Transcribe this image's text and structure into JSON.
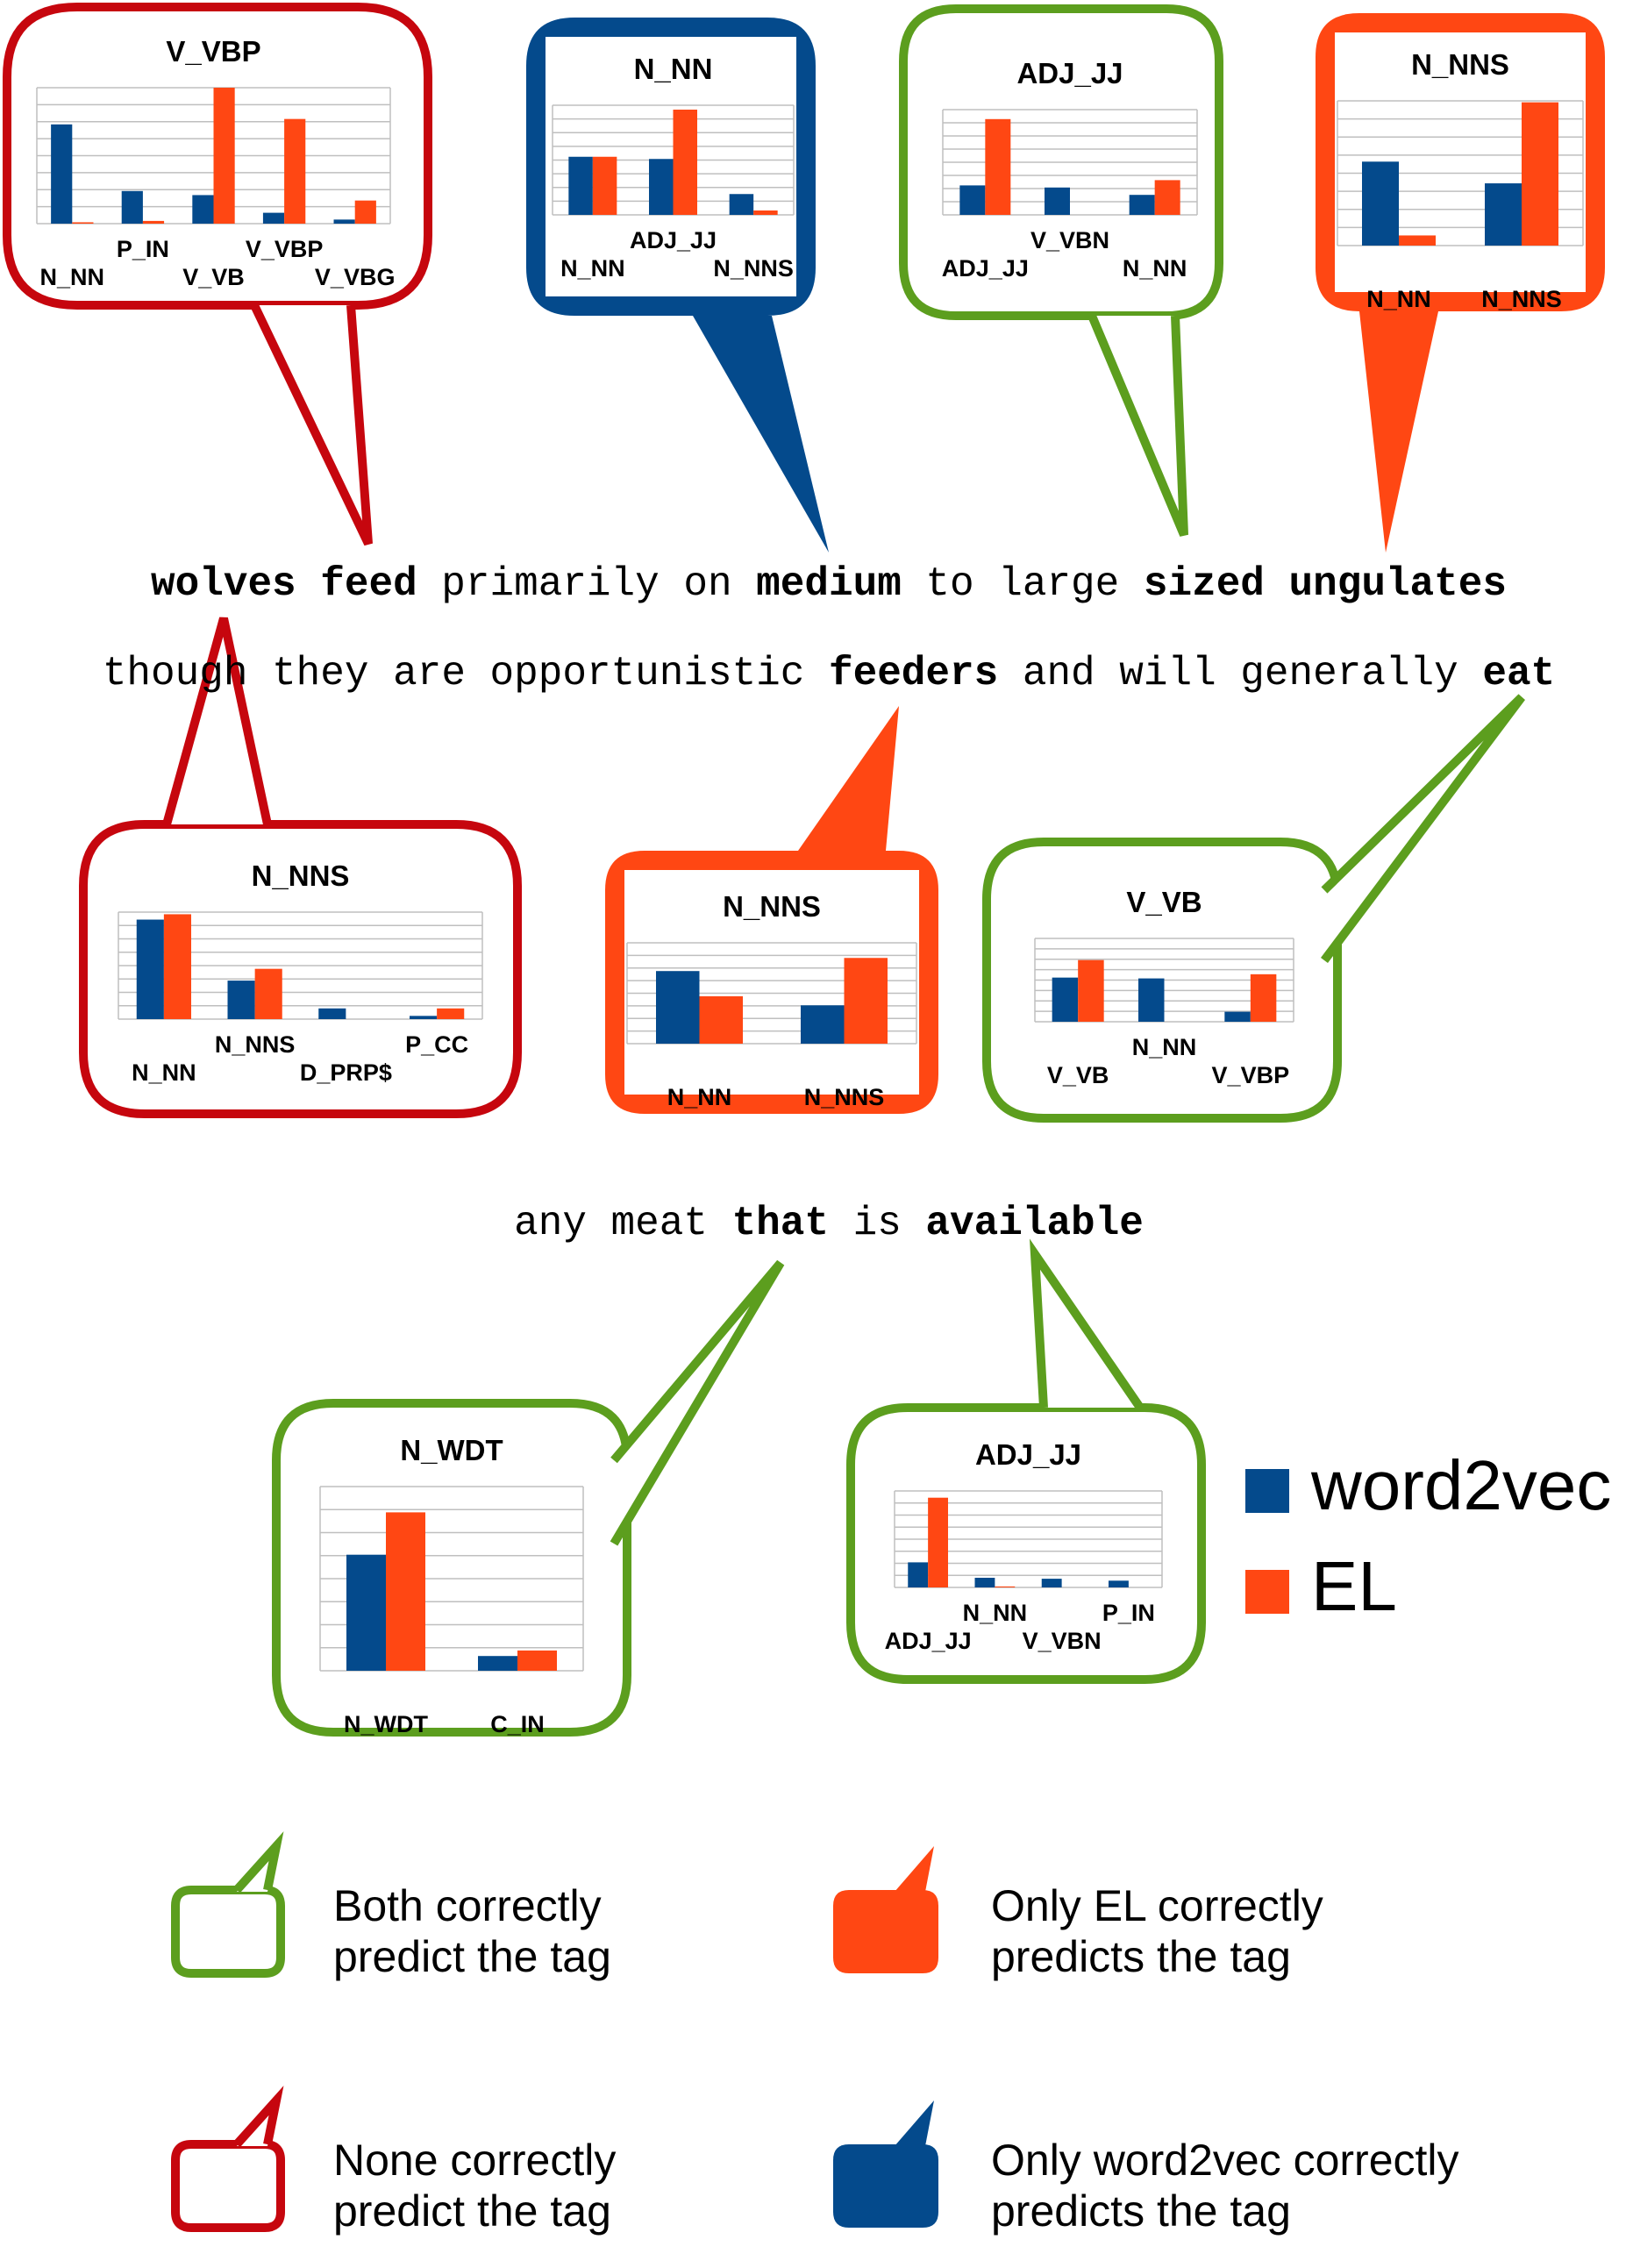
{
  "colors": {
    "word2vec": "#044A8C",
    "EL": "#FF4713",
    "both_correct": "#5C9E1E",
    "none_correct": "#C6060E",
    "only_el": "#FF4713",
    "only_word2vec": "#044A8C",
    "grid": "#BFBFBF"
  },
  "sentence": [
    [
      {
        "text": "wolves",
        "bold": true
      },
      {
        "text": "feed",
        "bold": true
      },
      {
        "text": "primarily",
        "bold": false
      },
      {
        "text": "on",
        "bold": false
      },
      {
        "text": "medium",
        "bold": true
      },
      {
        "text": "to",
        "bold": false
      },
      {
        "text": "large",
        "bold": false
      },
      {
        "text": "sized",
        "bold": true
      },
      {
        "text": "ungulates",
        "bold": true
      }
    ],
    [
      {
        "text": "though",
        "bold": false
      },
      {
        "text": "they",
        "bold": false
      },
      {
        "text": "are",
        "bold": false
      },
      {
        "text": "opportunistic",
        "bold": false
      },
      {
        "text": "feeders",
        "bold": true
      },
      {
        "text": "and",
        "bold": false
      },
      {
        "text": "will",
        "bold": false
      },
      {
        "text": "generally",
        "bold": false
      },
      {
        "text": "eat",
        "bold": true
      }
    ],
    [
      {
        "text": "any",
        "bold": false
      },
      {
        "text": "meat",
        "bold": false
      },
      {
        "text": "that",
        "bold": true
      },
      {
        "text": "is",
        "bold": false
      },
      {
        "text": "available",
        "bold": true
      }
    ]
  ],
  "chart_data": [
    {
      "type": "bar",
      "word": "wolves",
      "status": "none_correct",
      "title": "V_VBP",
      "categories": [
        "N_NN",
        "P_IN",
        "V_VB",
        "V_VBP",
        "V_VBG"
      ],
      "series": [
        {
          "name": "word2vec",
          "values": [
            0.73,
            0.24,
            0.21,
            0.08,
            0.03
          ]
        },
        {
          "name": "EL",
          "values": [
            0.01,
            0.02,
            1.0,
            0.77,
            0.17
          ]
        }
      ]
    },
    {
      "type": "bar",
      "word": "medium",
      "status": "only_word2vec",
      "title": "N_NN",
      "categories": [
        "N_NN",
        "ADJ_JJ",
        "N_NNS"
      ],
      "series": [
        {
          "name": "word2vec",
          "values": [
            0.53,
            0.51,
            0.19
          ]
        },
        {
          "name": "EL",
          "values": [
            0.53,
            0.96,
            0.04
          ]
        }
      ]
    },
    {
      "type": "bar",
      "word": "sized",
      "status": "both_correct",
      "title": "ADJ_JJ",
      "categories": [
        "ADJ_JJ",
        "V_VBN",
        "N_NN"
      ],
      "series": [
        {
          "name": "word2vec",
          "values": [
            0.28,
            0.26,
            0.19
          ]
        },
        {
          "name": "EL",
          "values": [
            0.91,
            0.0,
            0.33
          ]
        }
      ]
    },
    {
      "type": "bar",
      "word": "ungulates",
      "status": "only_el",
      "title": "N_NNS",
      "categories": [
        "N_NN",
        "N_NNS"
      ],
      "series": [
        {
          "name": "word2vec",
          "values": [
            0.58,
            0.43
          ]
        },
        {
          "name": "EL",
          "values": [
            0.07,
            0.99
          ]
        }
      ]
    },
    {
      "type": "bar",
      "word": "feed",
      "status": "none_correct",
      "title": "N_NNS",
      "categories": [
        "N_NN",
        "N_NNS",
        "D_PRP$",
        "P_CC"
      ],
      "series": [
        {
          "name": "word2vec",
          "values": [
            0.93,
            0.36,
            0.1,
            0.03
          ]
        },
        {
          "name": "EL",
          "values": [
            0.98,
            0.47,
            0.0,
            0.1
          ]
        }
      ]
    },
    {
      "type": "bar",
      "word": "feeders",
      "status": "only_el",
      "title": "N_NNS",
      "categories": [
        "N_NN",
        "N_NNS"
      ],
      "series": [
        {
          "name": "word2vec",
          "values": [
            0.72,
            0.38
          ]
        },
        {
          "name": "EL",
          "values": [
            0.47,
            0.85
          ]
        }
      ]
    },
    {
      "type": "bar",
      "word": "eat",
      "status": "both_correct",
      "title": "V_VB",
      "categories": [
        "V_VB",
        "N_NN",
        "V_VBP"
      ],
      "series": [
        {
          "name": "word2vec",
          "values": [
            0.53,
            0.52,
            0.12
          ]
        },
        {
          "name": "EL",
          "values": [
            0.74,
            0.0,
            0.57
          ]
        }
      ]
    },
    {
      "type": "bar",
      "word": "that",
      "status": "both_correct",
      "title": "N_WDT",
      "categories": [
        "N_WDT",
        "C_IN"
      ],
      "series": [
        {
          "name": "word2vec",
          "values": [
            0.63,
            0.08
          ]
        },
        {
          "name": "EL",
          "values": [
            0.86,
            0.11
          ]
        }
      ]
    },
    {
      "type": "bar",
      "word": "available",
      "status": "both_correct",
      "title": "ADJ_JJ",
      "categories": [
        "ADJ_JJ",
        "N_NN",
        "V_VBN",
        "P_IN"
      ],
      "series": [
        {
          "name": "word2vec",
          "values": [
            0.26,
            0.1,
            0.09,
            0.07
          ]
        },
        {
          "name": "EL",
          "values": [
            0.93,
            0.01,
            0.0,
            0.0
          ]
        }
      ]
    }
  ],
  "series_legend": [
    {
      "label": "word2vec",
      "color": "#044A8C"
    },
    {
      "label": "EL",
      "color": "#FF4713"
    }
  ],
  "status_legend": [
    {
      "status": "both_correct",
      "fill": false,
      "line1": "Both correctly",
      "line2": "predict the tag"
    },
    {
      "status": "only_el",
      "fill": true,
      "line1": "Only EL correctly",
      "line2": "predicts the tag"
    },
    {
      "status": "none_correct",
      "fill": false,
      "line1": "None correctly",
      "line2": "predict the tag"
    },
    {
      "status": "only_word2vec",
      "fill": true,
      "line1": "Only word2vec correctly",
      "line2": "predicts the tag"
    }
  ]
}
